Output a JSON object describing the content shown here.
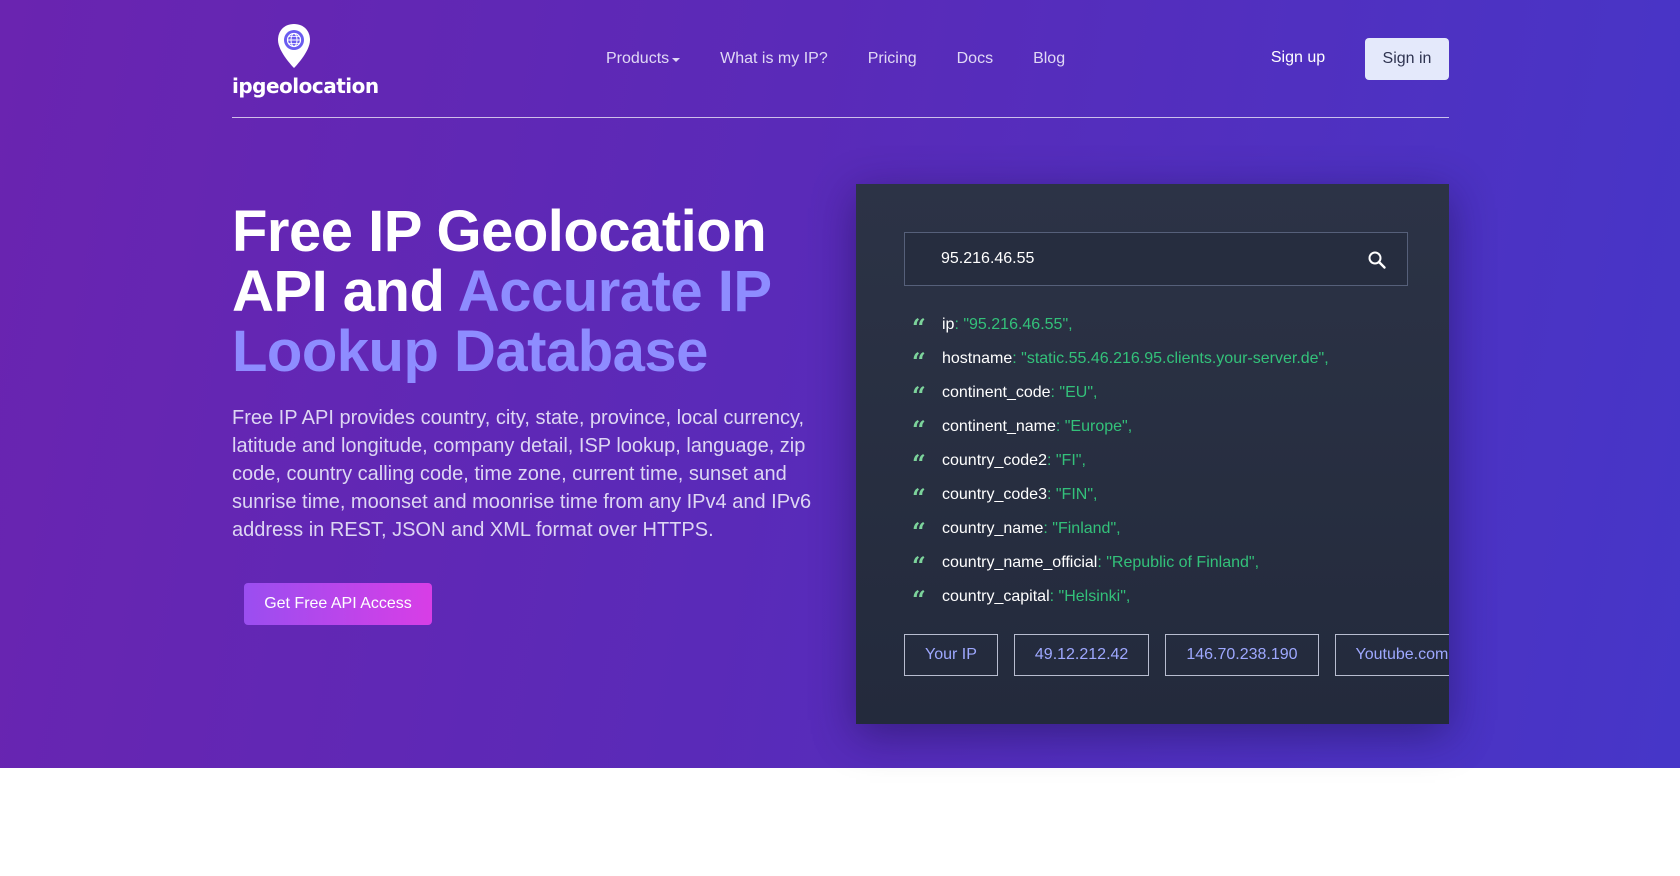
{
  "header": {
    "logo_text": "ipgeolocation",
    "nav": [
      {
        "label": "Products",
        "has_dropdown": true
      },
      {
        "label": "What is my IP?",
        "has_dropdown": false
      },
      {
        "label": "Pricing",
        "has_dropdown": false
      },
      {
        "label": "Docs",
        "has_dropdown": false
      },
      {
        "label": "Blog",
        "has_dropdown": false
      }
    ],
    "signup_label": "Sign up",
    "signin_label": "Sign in"
  },
  "hero": {
    "headline_part1": "Free IP Geolocation API and ",
    "headline_accent": "Accurate IP Lookup Database",
    "description": "Free IP API provides country, city, state, province, local currency, latitude and longitude, company detail, ISP lookup, language, zip code, country calling code, time zone, current time, sunset and sunrise time, moonset and moonrise time from any IPv4 and IPv6 address in REST, JSON and XML format over HTTPS.",
    "cta_label": "Get Free API Access"
  },
  "lookup": {
    "search_value": "95.216.46.55",
    "fields": [
      {
        "key": "ip",
        "value": "\"95.216.46.55\","
      },
      {
        "key": "hostname",
        "value": "\"static.55.46.216.95.clients.your-server.de\","
      },
      {
        "key": "continent_code",
        "value": "\"EU\","
      },
      {
        "key": "continent_name",
        "value": "\"Europe\","
      },
      {
        "key": "country_code2",
        "value": "\"FI\","
      },
      {
        "key": "country_code3",
        "value": "\"FIN\","
      },
      {
        "key": "country_name",
        "value": "\"Finland\","
      },
      {
        "key": "country_name_official",
        "value": "\"Republic of Finland\","
      },
      {
        "key": "country_capital",
        "value": "\"Helsinki\","
      }
    ],
    "chips": [
      "Your IP",
      "49.12.212.42",
      "146.70.238.190",
      "Youtube.com"
    ]
  },
  "colors": {
    "accent": "#8e8cff",
    "json_value": "#33c17a",
    "panel_bg": "#2a3144"
  }
}
